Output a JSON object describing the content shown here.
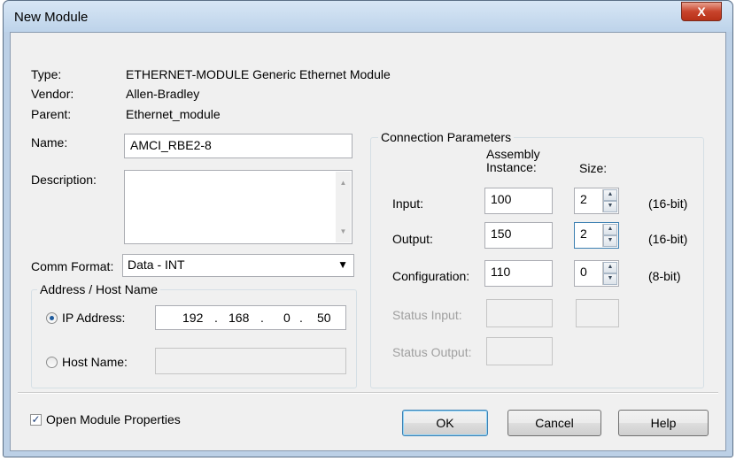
{
  "window": {
    "title": "New Module",
    "close_glyph": "X"
  },
  "info": {
    "type_label": "Type:",
    "type_value": "ETHERNET-MODULE Generic Ethernet Module",
    "vendor_label": "Vendor:",
    "vendor_value": "Allen-Bradley",
    "parent_label": "Parent:",
    "parent_value": "Ethernet_module",
    "name_label": "Name:",
    "name_value": "AMCI_RBE2-8",
    "description_label": "Description:",
    "description_value": "",
    "comm_format_label": "Comm Format:",
    "comm_format_value": "Data - INT"
  },
  "address": {
    "group_title": "Address / Host Name",
    "ip_label": "IP Address:",
    "ip_octets": [
      "192",
      "168",
      "0",
      "50"
    ],
    "host_label": "Host Name:",
    "host_value": "",
    "selected": "ip"
  },
  "connection": {
    "group_title": "Connection Parameters",
    "assembly_header_1": "Assembly",
    "assembly_header_2": "Instance:",
    "size_header": "Size:",
    "rows": [
      {
        "label": "Input:",
        "instance": "100",
        "size": "2",
        "unit": "(16-bit)"
      },
      {
        "label": "Output:",
        "instance": "150",
        "size": "2",
        "unit": "(16-bit)"
      },
      {
        "label": "Configuration:",
        "instance": "110",
        "size": "0",
        "unit": "(8-bit)"
      }
    ],
    "status_input_label": "Status Input:",
    "status_output_label": "Status Output:"
  },
  "footer": {
    "open_props_label": "Open Module Properties",
    "open_props_checked": true,
    "ok_label": "OK",
    "cancel_label": "Cancel",
    "help_label": "Help"
  },
  "icons": {
    "spin_up": "▲",
    "spin_down": "▼",
    "combo_arrow": "▼",
    "check": "✓"
  },
  "colors": {
    "close_button": "#c8442c",
    "title_gradient": "#bdd3ea",
    "dialog_bg": "#f0f0f0"
  }
}
